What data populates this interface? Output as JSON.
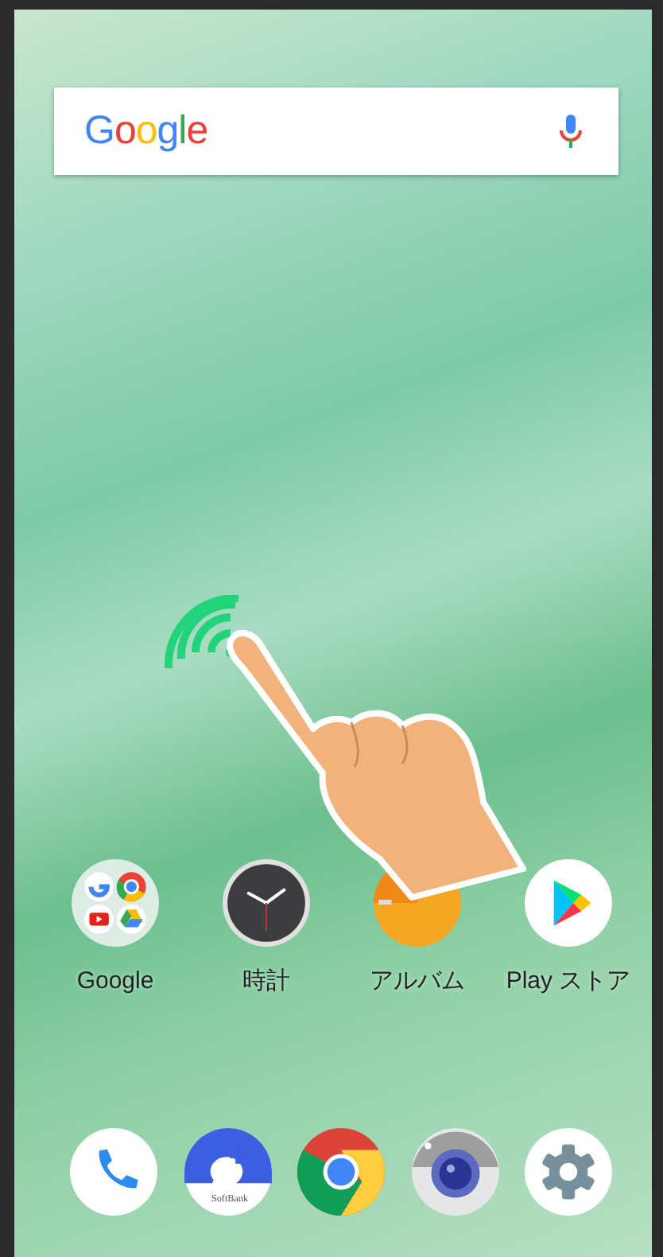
{
  "search_bar": {
    "logo": "Google"
  },
  "apps": [
    {
      "label": "Google",
      "kind": "folder"
    },
    {
      "label": "時計",
      "kind": "clock"
    },
    {
      "label": "アルバム",
      "kind": "album"
    },
    {
      "label": "Play ストア",
      "kind": "play"
    }
  ],
  "dock": [
    {
      "kind": "phone"
    },
    {
      "kind": "message",
      "caption": "SoftBank"
    },
    {
      "kind": "chrome"
    },
    {
      "kind": "camera"
    },
    {
      "kind": "settings"
    }
  ]
}
